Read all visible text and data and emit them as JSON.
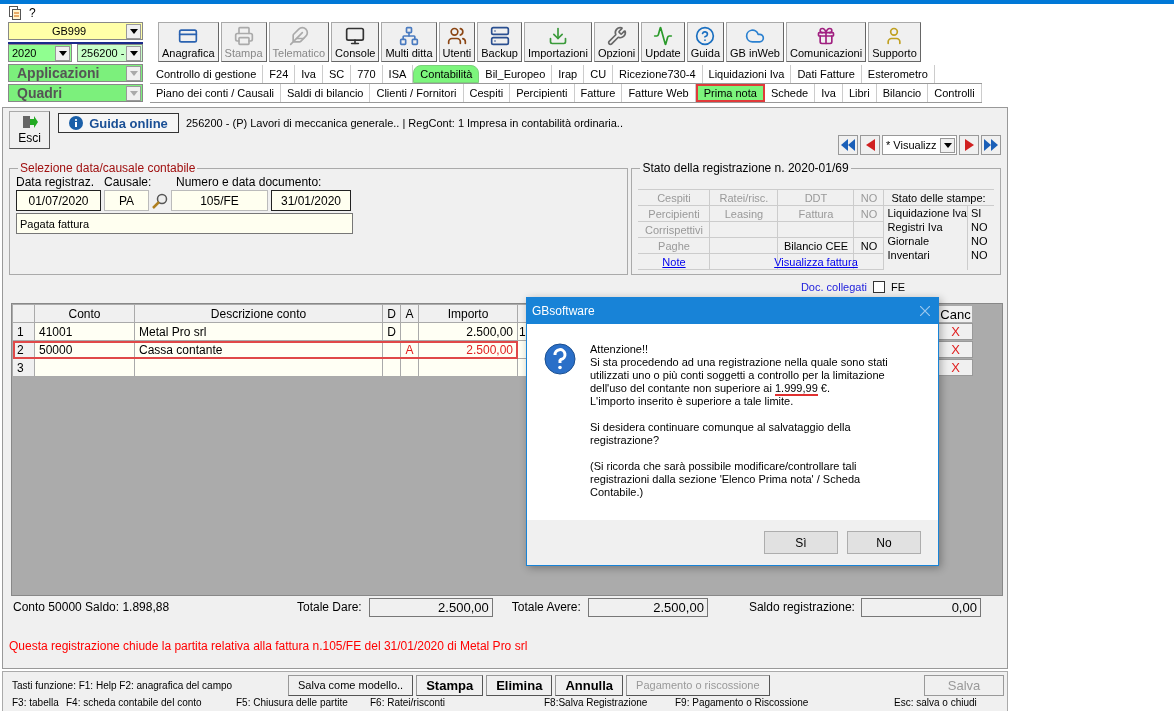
{
  "menu": {
    "help": "?"
  },
  "selectors": {
    "company": "GB999",
    "year": "2020",
    "firm": "256200 -",
    "applications": "Applicazioni",
    "sections": "Quadri"
  },
  "toolbar": [
    {
      "label": "Anagrafica",
      "disabled": false
    },
    {
      "label": "Stampa",
      "disabled": true
    },
    {
      "label": "Telematico",
      "disabled": true
    },
    {
      "label": "Console",
      "disabled": false
    },
    {
      "label": "Multi ditta",
      "disabled": false
    },
    {
      "label": "Utenti",
      "disabled": false
    },
    {
      "label": "Backup",
      "disabled": false
    },
    {
      "label": "Importazioni",
      "disabled": false
    },
    {
      "label": "Opzioni",
      "disabled": false
    },
    {
      "label": "Update",
      "disabled": false
    },
    {
      "label": "Guida",
      "disabled": false
    },
    {
      "label": "GB inWeb",
      "disabled": false
    },
    {
      "label": "Comunicazioni",
      "disabled": false
    },
    {
      "label": "Supporto",
      "disabled": false
    }
  ],
  "module_tabs": [
    {
      "label": "Controllo di gestione",
      "selected": false
    },
    {
      "label": "F24",
      "selected": false
    },
    {
      "label": "Iva",
      "selected": false
    },
    {
      "label": "SC",
      "selected": false
    },
    {
      "label": "770",
      "selected": false
    },
    {
      "label": "ISA",
      "selected": false
    },
    {
      "label": "Contabilità",
      "selected": true
    },
    {
      "label": "Bil_Europeo",
      "selected": false
    },
    {
      "label": "Irap",
      "selected": false
    },
    {
      "label": "CU",
      "selected": false
    },
    {
      "label": "Ricezione730-4",
      "selected": false
    },
    {
      "label": "Liquidazioni Iva",
      "selected": false
    },
    {
      "label": "Dati Fatture",
      "selected": false
    },
    {
      "label": "Esterometro",
      "selected": false
    }
  ],
  "sub_tabs": [
    {
      "label": "Piano dei conti / Causali",
      "selected": false
    },
    {
      "label": "Saldi di bilancio",
      "selected": false
    },
    {
      "label": "Clienti / Fornitori",
      "selected": false
    },
    {
      "label": "Cespiti",
      "selected": false
    },
    {
      "label": "Percipienti",
      "selected": false
    },
    {
      "label": "Fatture",
      "selected": false
    },
    {
      "label": "Fatture Web",
      "selected": false
    },
    {
      "label": "Prima nota",
      "selected": true
    },
    {
      "label": "Schede",
      "selected": false
    },
    {
      "label": "Iva",
      "selected": false
    },
    {
      "label": "Libri",
      "selected": false
    },
    {
      "label": "Bilancio",
      "selected": false
    },
    {
      "label": "Controlli",
      "selected": false
    }
  ],
  "exit_button": "Esci",
  "guide_button": "Guida online",
  "firm_info": "256200 - (P) Lavori di meccanica generale.. | RegCont: 1 Impresa  in contabilità ordinaria..",
  "navigator": {
    "filter": "* Visualizz"
  },
  "selection": {
    "title": "Selezione data/causale contabile",
    "date_label": "Data registraz.",
    "causale_label": "Causale:",
    "document_label": "Numero e data documento:",
    "date": "01/07/2020",
    "causale": "PA",
    "doc_number": "105/FE",
    "doc_date": "31/01/2020",
    "description": "Pagata fattura"
  },
  "status": {
    "title": "Stato della registrazione n. 2020-01/69",
    "grid": [
      [
        {
          "kind": "text",
          "text": "Cespiti",
          "disabled": true
        },
        {
          "kind": "text",
          "text": "Ratei/risc.",
          "disabled": true
        },
        {
          "kind": "text",
          "text": "DDT",
          "disabled": true
        },
        {
          "kind": "text",
          "text": "NO",
          "disabled": true
        }
      ],
      [
        {
          "kind": "text",
          "text": "Percipienti",
          "disabled": true
        },
        {
          "kind": "text",
          "text": "Leasing",
          "disabled": true
        },
        {
          "kind": "text",
          "text": "Fattura",
          "disabled": true
        },
        {
          "kind": "text",
          "text": "NO",
          "disabled": true
        }
      ],
      [
        {
          "kind": "text",
          "text": "Corrispettivi",
          "disabled": true
        },
        {
          "kind": "empty"
        },
        {
          "kind": "empty"
        },
        {
          "kind": "empty"
        }
      ],
      [
        {
          "kind": "text",
          "text": "Paghe",
          "disabled": true
        },
        {
          "kind": "empty"
        },
        {
          "kind": "text",
          "text": "Bilancio CEE",
          "disabled": false
        },
        {
          "kind": "text",
          "text": "NO",
          "disabled": false
        }
      ],
      [
        {
          "kind": "link",
          "text": "Note"
        },
        {
          "kind": "empty"
        },
        {
          "kind": "link",
          "text": "Visualizza fattura"
        },
        {
          "kind": "empty"
        }
      ]
    ],
    "prints_title": "Stato delle stampe:",
    "prints": [
      {
        "label": "Liquidazione Iva",
        "value": "SI"
      },
      {
        "label": "Registri Iva",
        "value": "NO"
      },
      {
        "label": "Giornale",
        "value": "NO"
      },
      {
        "label": "Inventari",
        "value": "NO"
      }
    ]
  },
  "linked_docs": {
    "label": "Doc. collegati",
    "checked": false,
    "option": "FE"
  },
  "entries": {
    "columns": [
      "Conto",
      "Descrizione conto",
      "D",
      "A",
      "Importo"
    ],
    "cancel_column": "Canc",
    "rows": [
      {
        "number": "1",
        "account": "41001",
        "description": "Metal Pro srl",
        "d": "D",
        "importo": "2.500,00",
        "column_6": "1",
        "cancel": "X",
        "highlighted": false
      },
      {
        "number": "2",
        "account": "50000",
        "description": "Cassa contante",
        "a": "A",
        "importo": "2.500,00",
        "cancel": "X",
        "highlighted": true
      },
      {
        "number": "3",
        "cancel": "X",
        "highlighted": false
      }
    ]
  },
  "totals": {
    "balance_info": "Conto 50000 Saldo: 1.898,88",
    "dare_label": "Totale Dare:",
    "dare": "2.500,00",
    "avere_label": "Totale Avere:",
    "avere": "2.500,00",
    "saldo_label": "Saldo registrazione:",
    "saldo": "0,00"
  },
  "notice": "Questa registrazione chiude la partita relativa alla fattura n.105/FE del 31/01/2020 di Metal Pro srl",
  "function_keys_intro": "Tasti funzione:  F1: Help  F2: anagrafica del campo",
  "actions": [
    {
      "label": "Salva come modello..",
      "kind": "normal",
      "disabled": false
    },
    {
      "label": "Stampa",
      "kind": "primary",
      "disabled": false
    },
    {
      "label": "Elimina",
      "kind": "primary",
      "disabled": false
    },
    {
      "label": "Annulla",
      "kind": "primary",
      "disabled": false
    },
    {
      "label": "Pagamento o riscossione",
      "kind": "normal",
      "disabled": true
    }
  ],
  "save_button": {
    "label": "Salva",
    "disabled": true
  },
  "function_keys": [
    "F3: tabella",
    "F4: scheda contabile del conto",
    "F5: Chiusura delle partite",
    "F6: Ratei/risconti",
    "F8:Salva Registrazione",
    "F9: Pagamento o Riscossione",
    "Esc: salva o chiudi"
  ],
  "dialog": {
    "title": "GBsoftware",
    "heading": "Attenzione!!",
    "text_before": "Si sta procedendo ad una registrazione nella quale sono stati utilizzati uno o più conti soggetti a controllo per la limitazione dell'uso del contante non superiore ai ",
    "amount": "1.999,99",
    "text_after": " €.\nL'importo inserito è superiore a tale limite.",
    "question": "Si desidera continuare comunque al salvataggio della registrazione?",
    "reminder": "(Si ricorda che sarà possibile modificare/controllare tali registrazioni dalla sezione 'Elenco Prima nota' / Scheda Contabile.)",
    "buttons": [
      "Sì",
      "No"
    ]
  }
}
